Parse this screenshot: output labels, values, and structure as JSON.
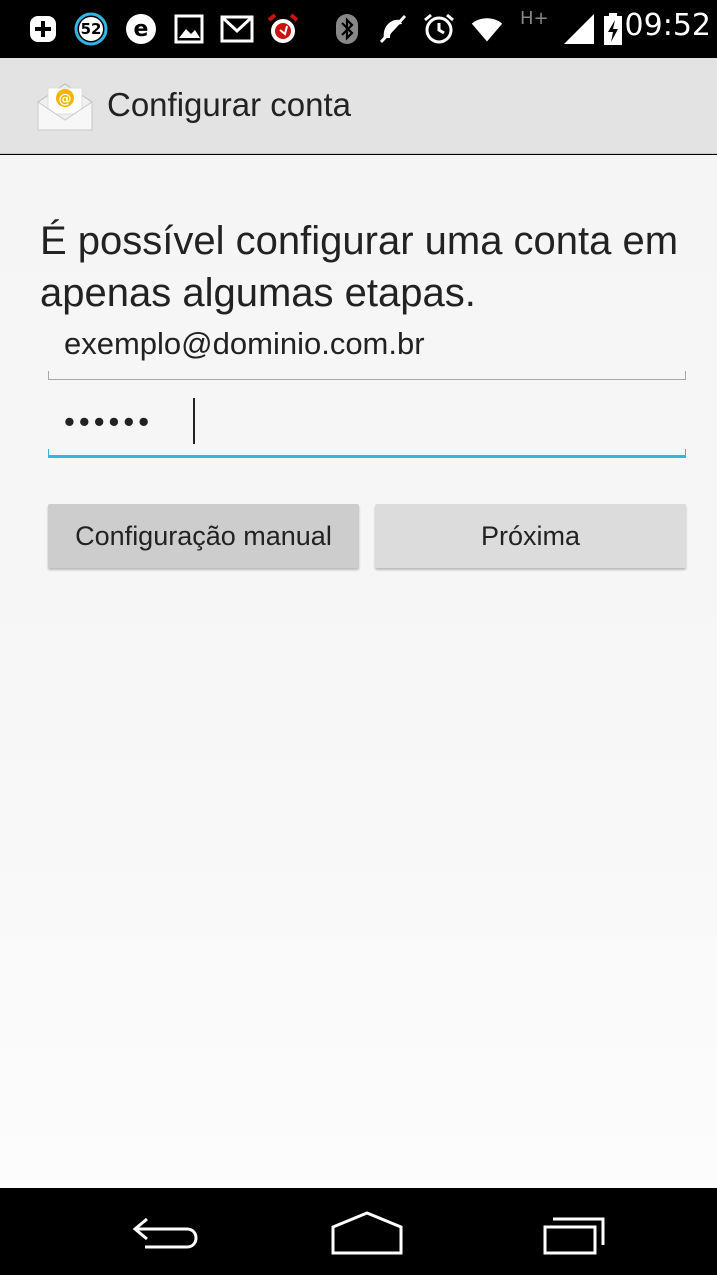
{
  "status_bar": {
    "notification_count": "52",
    "network_type": "H+",
    "time": "09:52",
    "icons": [
      "add-icon",
      "badge-52-icon",
      "e-app-icon",
      "gallery-icon",
      "gmail-icon",
      "alarm-red-icon",
      "bluetooth-icon",
      "mute-icon",
      "alarm-clock-icon",
      "wifi-icon",
      "network-type-icon",
      "signal-icon",
      "battery-icon"
    ]
  },
  "action_bar": {
    "title": "Configurar conta",
    "app_icon": "email-app-icon"
  },
  "form": {
    "instructions": "É possível configurar uma conta em apenas algumas etapas.",
    "email_value": "exemplo@dominio.com.br",
    "password_masked": "••••••"
  },
  "buttons": {
    "manual_setup": "Configuração manual",
    "next": "Próxima"
  },
  "nav_bar": {
    "icons": [
      "back-icon",
      "home-icon",
      "recent-apps-icon"
    ]
  },
  "colors": {
    "accent": "#33b5e5",
    "action_bar_bg": "#e3e3e3",
    "content_bg": "#f5f5f5",
    "alarm_red": "#cc1111"
  }
}
